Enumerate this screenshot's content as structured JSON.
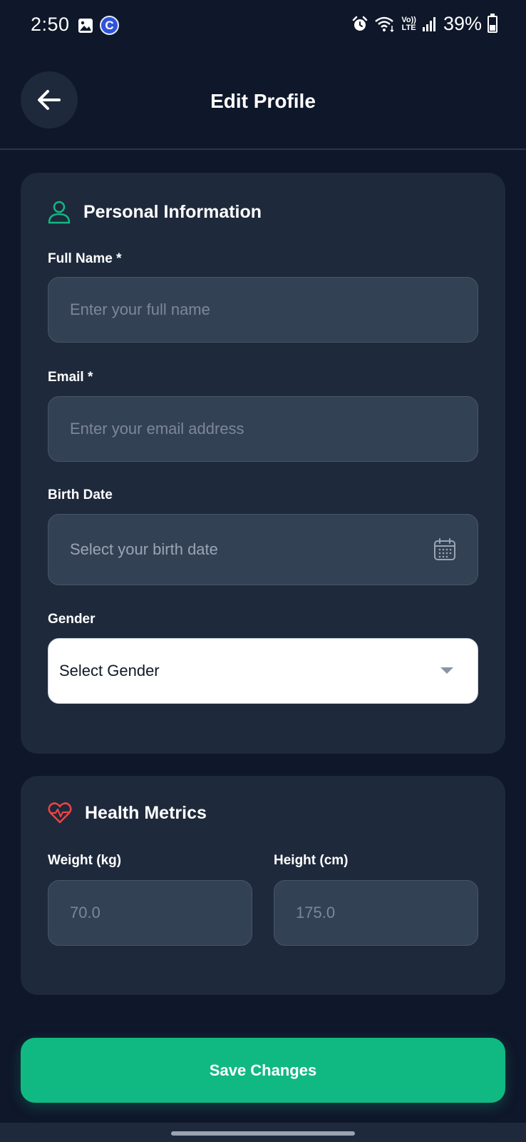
{
  "status_bar": {
    "time": "2:50",
    "lte_top": "Vo))",
    "lte_bottom": "LTE",
    "battery": "39%",
    "c_badge": "C",
    "icons": [
      "gallery-icon",
      "c-badge-icon",
      "alarm-icon",
      "wifi-icon",
      "signal-icon",
      "battery-icon"
    ]
  },
  "header": {
    "title": "Edit Profile",
    "back_icon": "arrow-left-icon"
  },
  "personal_info": {
    "heading": "Personal Information",
    "heading_icon": "user-icon",
    "full_name": {
      "label": "Full Name *",
      "value": "",
      "placeholder": "Enter your full name"
    },
    "email": {
      "label": "Email *",
      "value": "",
      "placeholder": "Enter your email address"
    },
    "birth_date": {
      "label": "Birth Date",
      "value": "",
      "placeholder": "Select your birth date",
      "icon": "calendar-icon"
    },
    "gender": {
      "label": "Gender",
      "selected": "Select Gender",
      "icon": "chevron-down-icon"
    }
  },
  "health_metrics": {
    "heading": "Health Metrics",
    "heading_icon": "heart-pulse-icon",
    "weight": {
      "label": "Weight (kg)",
      "value": "",
      "placeholder": "70.0"
    },
    "height": {
      "label": "Height (cm)",
      "value": "",
      "placeholder": "175.0"
    }
  },
  "actions": {
    "save_label": "Save Changes"
  },
  "colors": {
    "background": "#0f172a",
    "card": "#1e293b",
    "input": "#334155",
    "accent_green": "#10b981",
    "heart_red": "#ef4444"
  }
}
